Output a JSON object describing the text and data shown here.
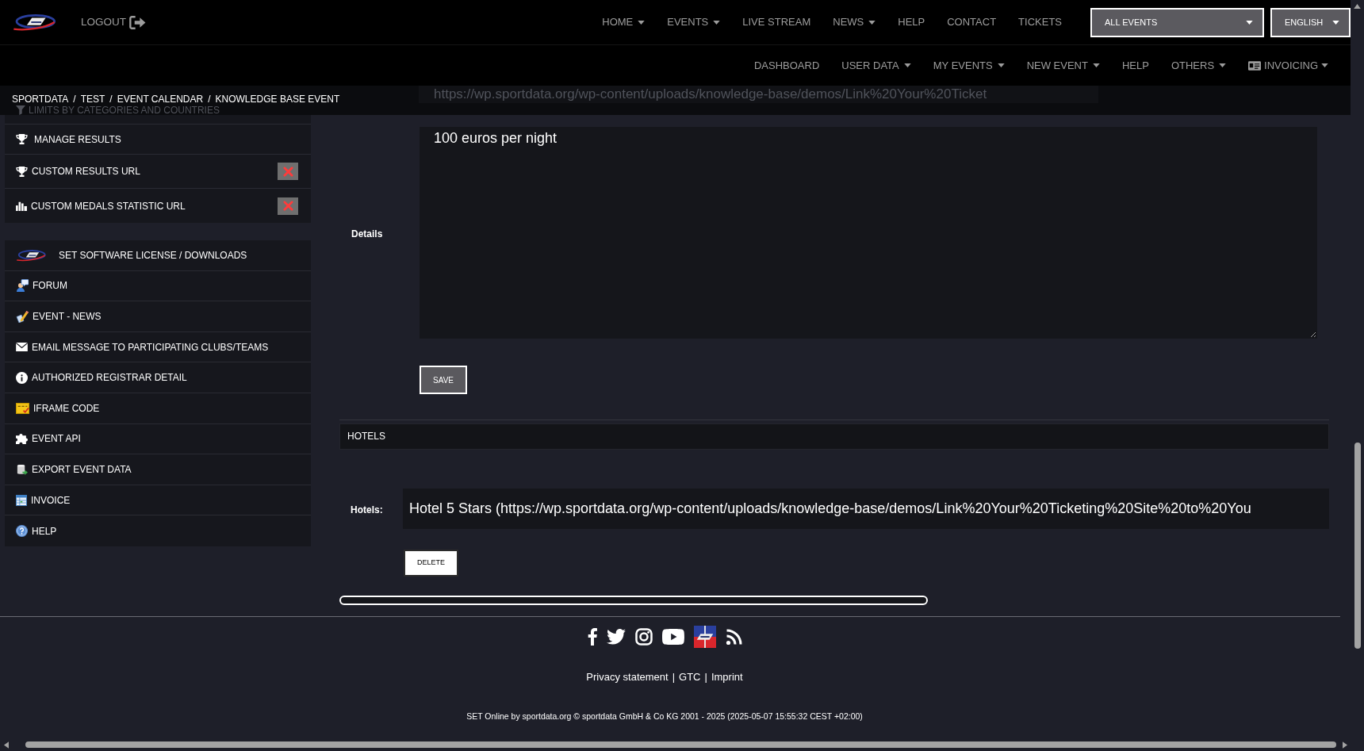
{
  "header": {
    "logout": "LOGOUT",
    "nav": [
      {
        "label": "HOME",
        "dropdown": true
      },
      {
        "label": "EVENTS",
        "dropdown": true
      },
      {
        "label": "LIVE STREAM",
        "dropdown": false
      },
      {
        "label": "NEWS",
        "dropdown": true
      },
      {
        "label": "HELP",
        "dropdown": false
      },
      {
        "label": "CONTACT",
        "dropdown": false
      },
      {
        "label": "TICKETS",
        "dropdown": false
      }
    ],
    "event_select": "ALL EVENTS",
    "language_select": "ENGLISH"
  },
  "subnav": [
    {
      "label": "DASHBOARD",
      "dropdown": false,
      "kind": "plain"
    },
    {
      "label": "USER DATA",
      "dropdown": true,
      "kind": "plain"
    },
    {
      "label": "MY EVENTS",
      "dropdown": true,
      "kind": "plain"
    },
    {
      "label": "NEW EVENT",
      "dropdown": true,
      "kind": "plain"
    },
    {
      "label": "HELP",
      "dropdown": false,
      "kind": "plain"
    },
    {
      "label": "OTHERS",
      "dropdown": true,
      "kind": "plain"
    },
    {
      "label": "INVOICING",
      "dropdown": true,
      "kind": "icon"
    }
  ],
  "breadcrumb": {
    "separator": "/",
    "items": [
      "SPORTDATA",
      "TEST",
      "EVENT CALENDAR",
      "KNOWLEDGE BASE EVENT"
    ]
  },
  "sidebar": {
    "partial_item": "LIMITS BY CATEGORIES AND COUNTRIES",
    "results_panel": [
      {
        "label": "MANAGE RESULTS",
        "removable": false
      },
      {
        "label": "CUSTOM RESULTS URL",
        "removable": true
      },
      {
        "label": "CUSTOM MEDALS STATISTIC URL",
        "removable": true
      }
    ],
    "tools_panel": [
      "SET SOFTWARE LICENSE / DOWNLOADS",
      "FORUM",
      "EVENT - NEWS",
      "EMAIL MESSAGE TO PARTICIPATING CLUBS/TEAMS",
      "AUTHORIZED REGISTRAR DETAIL",
      "IFRAME CODE",
      "EVENT API",
      "EXPORT EVENT DATA",
      "INVOICE",
      "HELP"
    ]
  },
  "main": {
    "partial_url_field": "https://wp.sportdata.org/wp-content/uploads/knowledge-base/demos/Link%20Your%20Ticket",
    "details": {
      "label": "Details",
      "value": "100 euros per night"
    },
    "save_button": "SAVE",
    "hotels_section": {
      "title": "HOTELS",
      "label": "Hotels:",
      "value": "Hotel 5 Stars (https://wp.sportdata.org/wp-content/uploads/knowledge-base/demos/Link%20Your%20Ticketing%20Site%20to%20You",
      "delete_button": "DELETE"
    }
  },
  "footer": {
    "links": [
      "Privacy statement",
      "GTC",
      "Imprint"
    ],
    "link_separator": "|",
    "copyright": "SET Online by sportdata.org © sportdata GmbH & Co KG 2001 - 2025 (2025-05-07 15:55:32 CEST +02:00)"
  }
}
